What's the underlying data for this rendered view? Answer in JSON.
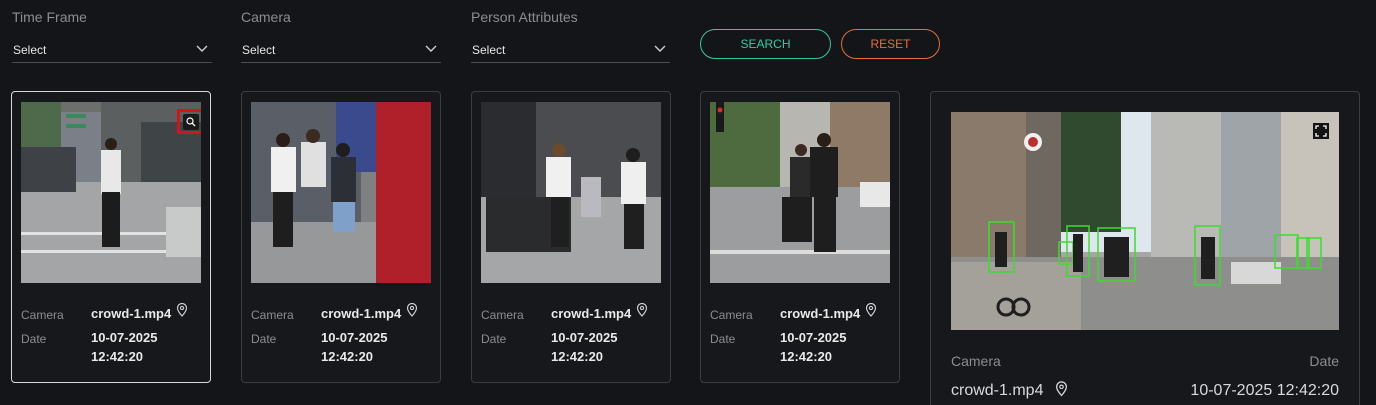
{
  "filters": [
    {
      "label": "Time Frame",
      "value": "Select"
    },
    {
      "label": "Camera",
      "value": "Select"
    },
    {
      "label": "Person Attributes",
      "value": "Select"
    }
  ],
  "actions": {
    "search": "SEARCH",
    "reset": "RESET"
  },
  "results": [
    {
      "camera_label": "Camera",
      "camera": "crowd-1.mp4",
      "date_label": "Date",
      "date": "10-07-2025",
      "time": "12:42:20"
    },
    {
      "camera_label": "Camera",
      "camera": "crowd-1.mp4",
      "date_label": "Date",
      "date": "10-07-2025",
      "time": "12:42:20"
    },
    {
      "camera_label": "Camera",
      "camera": "crowd-1.mp4",
      "date_label": "Date",
      "date": "10-07-2025",
      "time": "12:42:20"
    },
    {
      "camera_label": "Camera",
      "camera": "crowd-1.mp4",
      "date_label": "Date",
      "date": "10-07-2025",
      "time": "12:42:20"
    }
  ],
  "detail": {
    "camera_label": "Camera",
    "date_label": "Date",
    "camera": "crowd-1.mp4",
    "datetime": "10-07-2025 12:42:20"
  },
  "icons": {
    "dropdown": "chevron-down-icon",
    "location": "location-pin-icon",
    "zoom": "magnifier-icon",
    "fullscreen": "expand-icon"
  },
  "colors": {
    "background": "#141518",
    "search_accent": "#34c9a2",
    "reset_accent": "#e2703a",
    "zoom_highlight": "#d0161c",
    "detection_box": "#3ddc2f"
  }
}
